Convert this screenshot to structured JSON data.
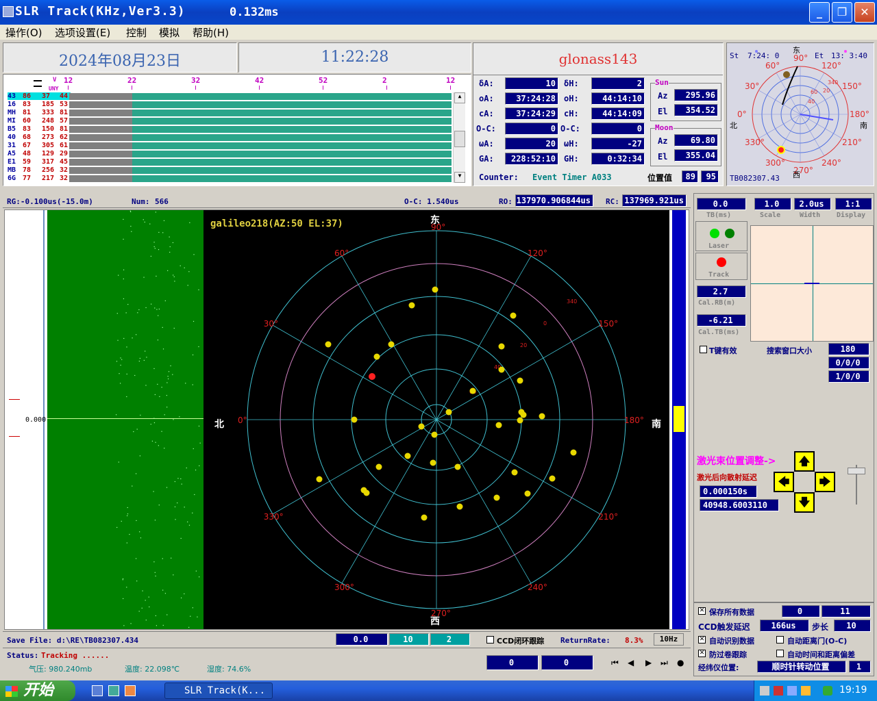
{
  "window": {
    "title": "SLR Track(KHz,Ver3.3)",
    "latency": "0.132ms"
  },
  "menu": [
    "操作(O)",
    "选项设置(E)",
    "控制",
    "模拟",
    "帮助(H)"
  ],
  "header": {
    "date": "2024年08月23日",
    "time": "11:22:28",
    "satellite": "glonass143"
  },
  "timeline": {
    "ticks": [
      "12",
      "22",
      "32",
      "42",
      "52",
      "2",
      "12"
    ],
    "tick_v": "V",
    "tick_uny": "UNY",
    "rows": [
      [
        "43",
        "86",
        "37",
        "44"
      ],
      [
        "16",
        "83",
        "185",
        "53"
      ],
      [
        "MH",
        "81",
        "333",
        "81"
      ],
      [
        "MI",
        "60",
        "248",
        "57"
      ],
      [
        "B5",
        "83",
        "150",
        "81"
      ],
      [
        "40",
        "68",
        "273",
        "62"
      ],
      [
        "31",
        "67",
        "305",
        "61"
      ],
      [
        "A5",
        "48",
        "129",
        "29"
      ],
      [
        "E1",
        "59",
        "317",
        "45"
      ],
      [
        "MB",
        "78",
        "256",
        "32"
      ],
      [
        "6G",
        "77",
        "217",
        "32"
      ]
    ]
  },
  "params": {
    "dA_label": "δA:",
    "dA": "10",
    "dH_label": "δH:",
    "dH": "2",
    "oA_label": "oA:",
    "oA": "37:24:28",
    "oH_label": "oH:",
    "oH": "44:14:10",
    "cA_label": "cA:",
    "cA": "37:24:29",
    "cH_label": "cH:",
    "cH": "44:14:09",
    "oc1_label": "O-C:",
    "oc1": "0",
    "oc2_label": "O-C:",
    "oc2": "0",
    "wA_label": "ωA:",
    "wA": "20",
    "wH_label": "ωH:",
    "wH": "-27",
    "GA_label": "GA:",
    "GA": "228:52:10",
    "GH_label": "GH:",
    "GH": "0:32:34",
    "counter_label": "Counter:",
    "counter": "Event Timer A033",
    "pos_label": "位置值",
    "pos1": "89",
    "pos2": "95"
  },
  "sun": {
    "title": "Sun",
    "az_label": "Az",
    "az": "295.96",
    "el_label": "El",
    "el": "354.52"
  },
  "moon": {
    "title": "Moon",
    "az_label": "Az",
    "az": "69.80",
    "el_label": "El",
    "el": "355.04"
  },
  "mini_polar": {
    "st_label": "St",
    "st": "7:24: 0",
    "et_label": "Et",
    "et": "13: 3:40",
    "east": "东",
    "west": "西",
    "north": "北",
    "south": "南",
    "file": "TB082307.43",
    "deg_labels": [
      "90°",
      "120°",
      "150°",
      "180°",
      "210°",
      "240°",
      "270°",
      "300°",
      "330°",
      "0°",
      "60°",
      "30°"
    ],
    "ring_labels": [
      "340",
      "40",
      "60",
      "20"
    ]
  },
  "status_line": {
    "rg": "RG:-0.100us(-15.0m)",
    "num_label": "Num:",
    "num": "566",
    "oc": "O-C: 1.540us",
    "ro_label": "RO:",
    "ro": "137970.906844us",
    "rc_label": "RC:",
    "rc": "137969.921us"
  },
  "scope": {
    "zero": "0.000",
    "tag": "galileo218(AZ:50 EL:37)",
    "east": "东",
    "west": "西",
    "north": "北",
    "south": "南",
    "deg_labels": [
      "90°",
      "120°",
      "150°",
      "180°",
      "210°",
      "240°",
      "270°",
      "300°",
      "330°",
      "0°",
      "30°",
      "60°"
    ],
    "ring_labels": [
      "340",
      "0",
      "20",
      "40",
      "60"
    ]
  },
  "right": {
    "tb": "0.0",
    "tb_label": "TB(ms)",
    "scale": "1.0",
    "scale_label": "Scale",
    "width": "2.0us",
    "width_label": "Width",
    "display": "1:1",
    "display_label": "Display",
    "laser_label": "Laser",
    "track_label": "Track",
    "calrb": "2.7",
    "calrb_label": "Cal.RB(m)",
    "caltb": "-6.21",
    "caltb_label": "Cal.TB(ms)",
    "tkey_label": "T键有效",
    "search_label": "搜索窗口大小",
    "search": "180",
    "v1": "0/0/0",
    "v2": "1/0/0",
    "laser_adj": "激光束位置调整->",
    "delay_label": "激光后向散射延迟",
    "delay1": "0.000150s",
    "delay2": "40948.6003110"
  },
  "options": {
    "save_all": "保存所有数据",
    "save_v1": "0",
    "save_v2": "11",
    "ccd_label": "CCD触发延迟",
    "ccd": "166us",
    "step_label": "步长",
    "step": "10",
    "auto_id": "自动识别数据",
    "auto_dist": "自动距离门(O-C)",
    "anti": "防过卷跟踪",
    "auto_time": "自动时间和距离偏差",
    "theo_label": "经纬仪位置:",
    "theo": "顺时针转动位置",
    "theo_v": "1"
  },
  "bottom": {
    "save_file": "Save File: d:\\RE\\TB082307.434",
    "b1": "0.0",
    "b2": "10",
    "b3": "2",
    "ccd_loop": "CCD闭环跟踪",
    "rr_label": "ReturnRate:",
    "rr": "8.3%",
    "freq": "10Hz",
    "status_label": "Status:",
    "status": "Tracking ......",
    "pressure": "气压: 980.240mb",
    "temp": "温度: 22.098℃",
    "humid": "湿度: 74.6%",
    "n1": "0",
    "n2": "0"
  },
  "taskbar": {
    "start": "开始",
    "task": "SLR Track(K...",
    "clock": "19:19"
  }
}
